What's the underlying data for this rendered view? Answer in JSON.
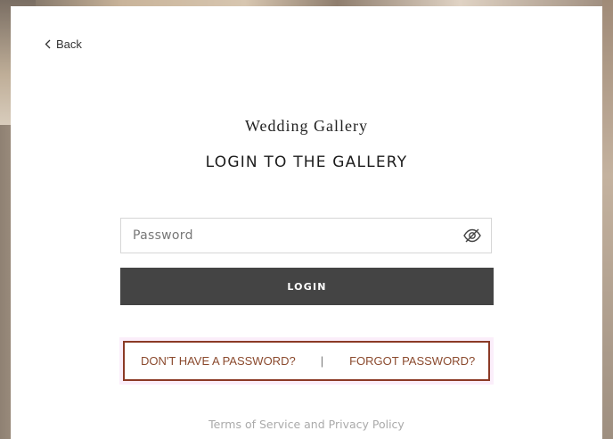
{
  "navigation": {
    "back_label": "Back"
  },
  "gallery": {
    "site_title": "Wedding Gallery",
    "heading": "LOGIN TO THE GALLERY"
  },
  "form": {
    "password_placeholder": "Password",
    "password_value": "",
    "login_label": "LOGIN"
  },
  "help_links": {
    "no_password_label": "DON'T HAVE A PASSWORD?",
    "separator": "|",
    "forgot_password_label": "FORGOT PASSWORD?"
  },
  "footer": {
    "terms_label": "Terms of Service and Privacy Policy"
  },
  "colors": {
    "button_background": "#444444",
    "link_color": "#8b4a2e",
    "highlight_border": "#8b3a26",
    "footer_text": "#aaaaaa"
  },
  "icons": {
    "back": "chevron-left-icon",
    "password_toggle": "eye-slash-icon"
  }
}
